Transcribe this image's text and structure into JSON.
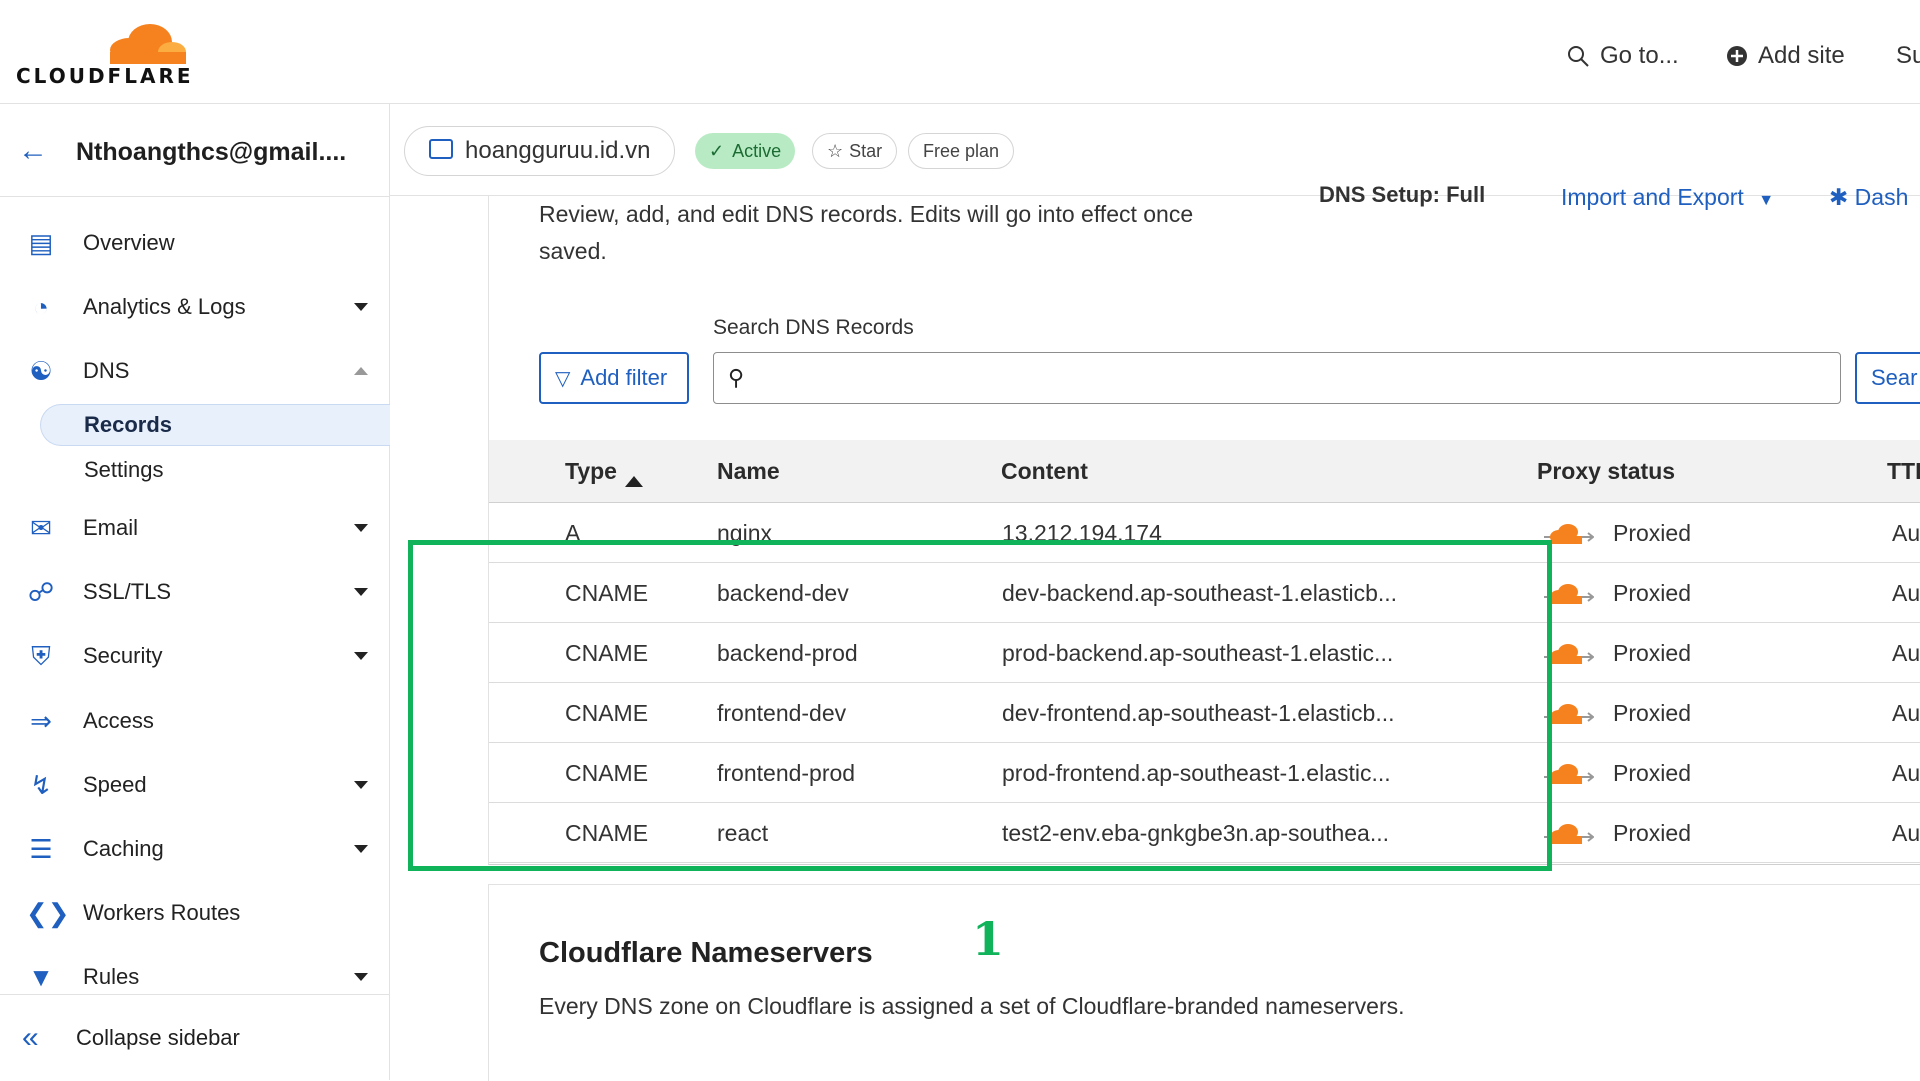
{
  "brand": {
    "name": "CLOUDFLARE",
    "colors": {
      "orange": "#f6821f",
      "blue": "#1f5fbf",
      "green": "#11b35a"
    }
  },
  "topnav": {
    "goto": "Go to...",
    "add_site": "Add site",
    "support_partial": "Su"
  },
  "account": {
    "email": "Nthoangthcs@gmail...."
  },
  "zone": {
    "domain": "hoangguruu.id.vn",
    "status": "Active",
    "star": "Star",
    "plan": "Free plan"
  },
  "sidebar": {
    "items": [
      {
        "label": "Overview",
        "icon": "document-icon"
      },
      {
        "label": "Analytics & Logs",
        "icon": "pie-chart-icon"
      },
      {
        "label": "DNS",
        "icon": "network-icon"
      },
      {
        "label": "Email",
        "icon": "email-icon"
      },
      {
        "label": "SSL/TLS",
        "icon": "lock-icon"
      },
      {
        "label": "Security",
        "icon": "shield-icon"
      },
      {
        "label": "Access",
        "icon": "access-icon"
      },
      {
        "label": "Speed",
        "icon": "lightning-icon"
      },
      {
        "label": "Caching",
        "icon": "server-icon"
      },
      {
        "label": "Workers Routes",
        "icon": "workers-icon"
      },
      {
        "label": "Rules",
        "icon": "funnel-icon"
      }
    ],
    "dns_sub": {
      "records": "Records",
      "settings": "Settings"
    },
    "collapse": "Collapse sidebar"
  },
  "dns": {
    "description": "Review, add, and edit DNS records. Edits will go into effect once saved.",
    "setup_partial": "DNS Setup: Full",
    "import_export": "Import and Export",
    "dashboard_partial": "Dash",
    "search_label": "Search DNS Records",
    "search_value": "",
    "add_filter": "Add filter",
    "search_button_partial": "Sear"
  },
  "table": {
    "headers": {
      "type": "Type",
      "name": "Name",
      "content": "Content",
      "proxy": "Proxy status",
      "ttl": "TTL"
    },
    "rows": [
      {
        "type": "A",
        "name": "nginx",
        "content": "13.212.194.174",
        "proxy": "Proxied",
        "ttl": "Au"
      },
      {
        "type": "CNAME",
        "name": "backend-dev",
        "content": "dev-backend.ap-southeast-1.elasticb...",
        "proxy": "Proxied",
        "ttl": "Au"
      },
      {
        "type": "CNAME",
        "name": "backend-prod",
        "content": "prod-backend.ap-southeast-1.elastic...",
        "proxy": "Proxied",
        "ttl": "Au"
      },
      {
        "type": "CNAME",
        "name": "frontend-dev",
        "content": "dev-frontend.ap-southeast-1.elasticb...",
        "proxy": "Proxied",
        "ttl": "Au"
      },
      {
        "type": "CNAME",
        "name": "frontend-prod",
        "content": "prod-frontend.ap-southeast-1.elastic...",
        "proxy": "Proxied",
        "ttl": "Au"
      },
      {
        "type": "CNAME",
        "name": "react",
        "content": "test2-env.eba-gnkgbe3n.ap-southea...",
        "proxy": "Proxied",
        "ttl": "Au"
      }
    ]
  },
  "nameservers": {
    "title": "Cloudflare Nameservers",
    "description": "Every DNS zone on Cloudflare is assigned a set of Cloudflare-branded nameservers."
  },
  "annotation": {
    "label": "1"
  }
}
